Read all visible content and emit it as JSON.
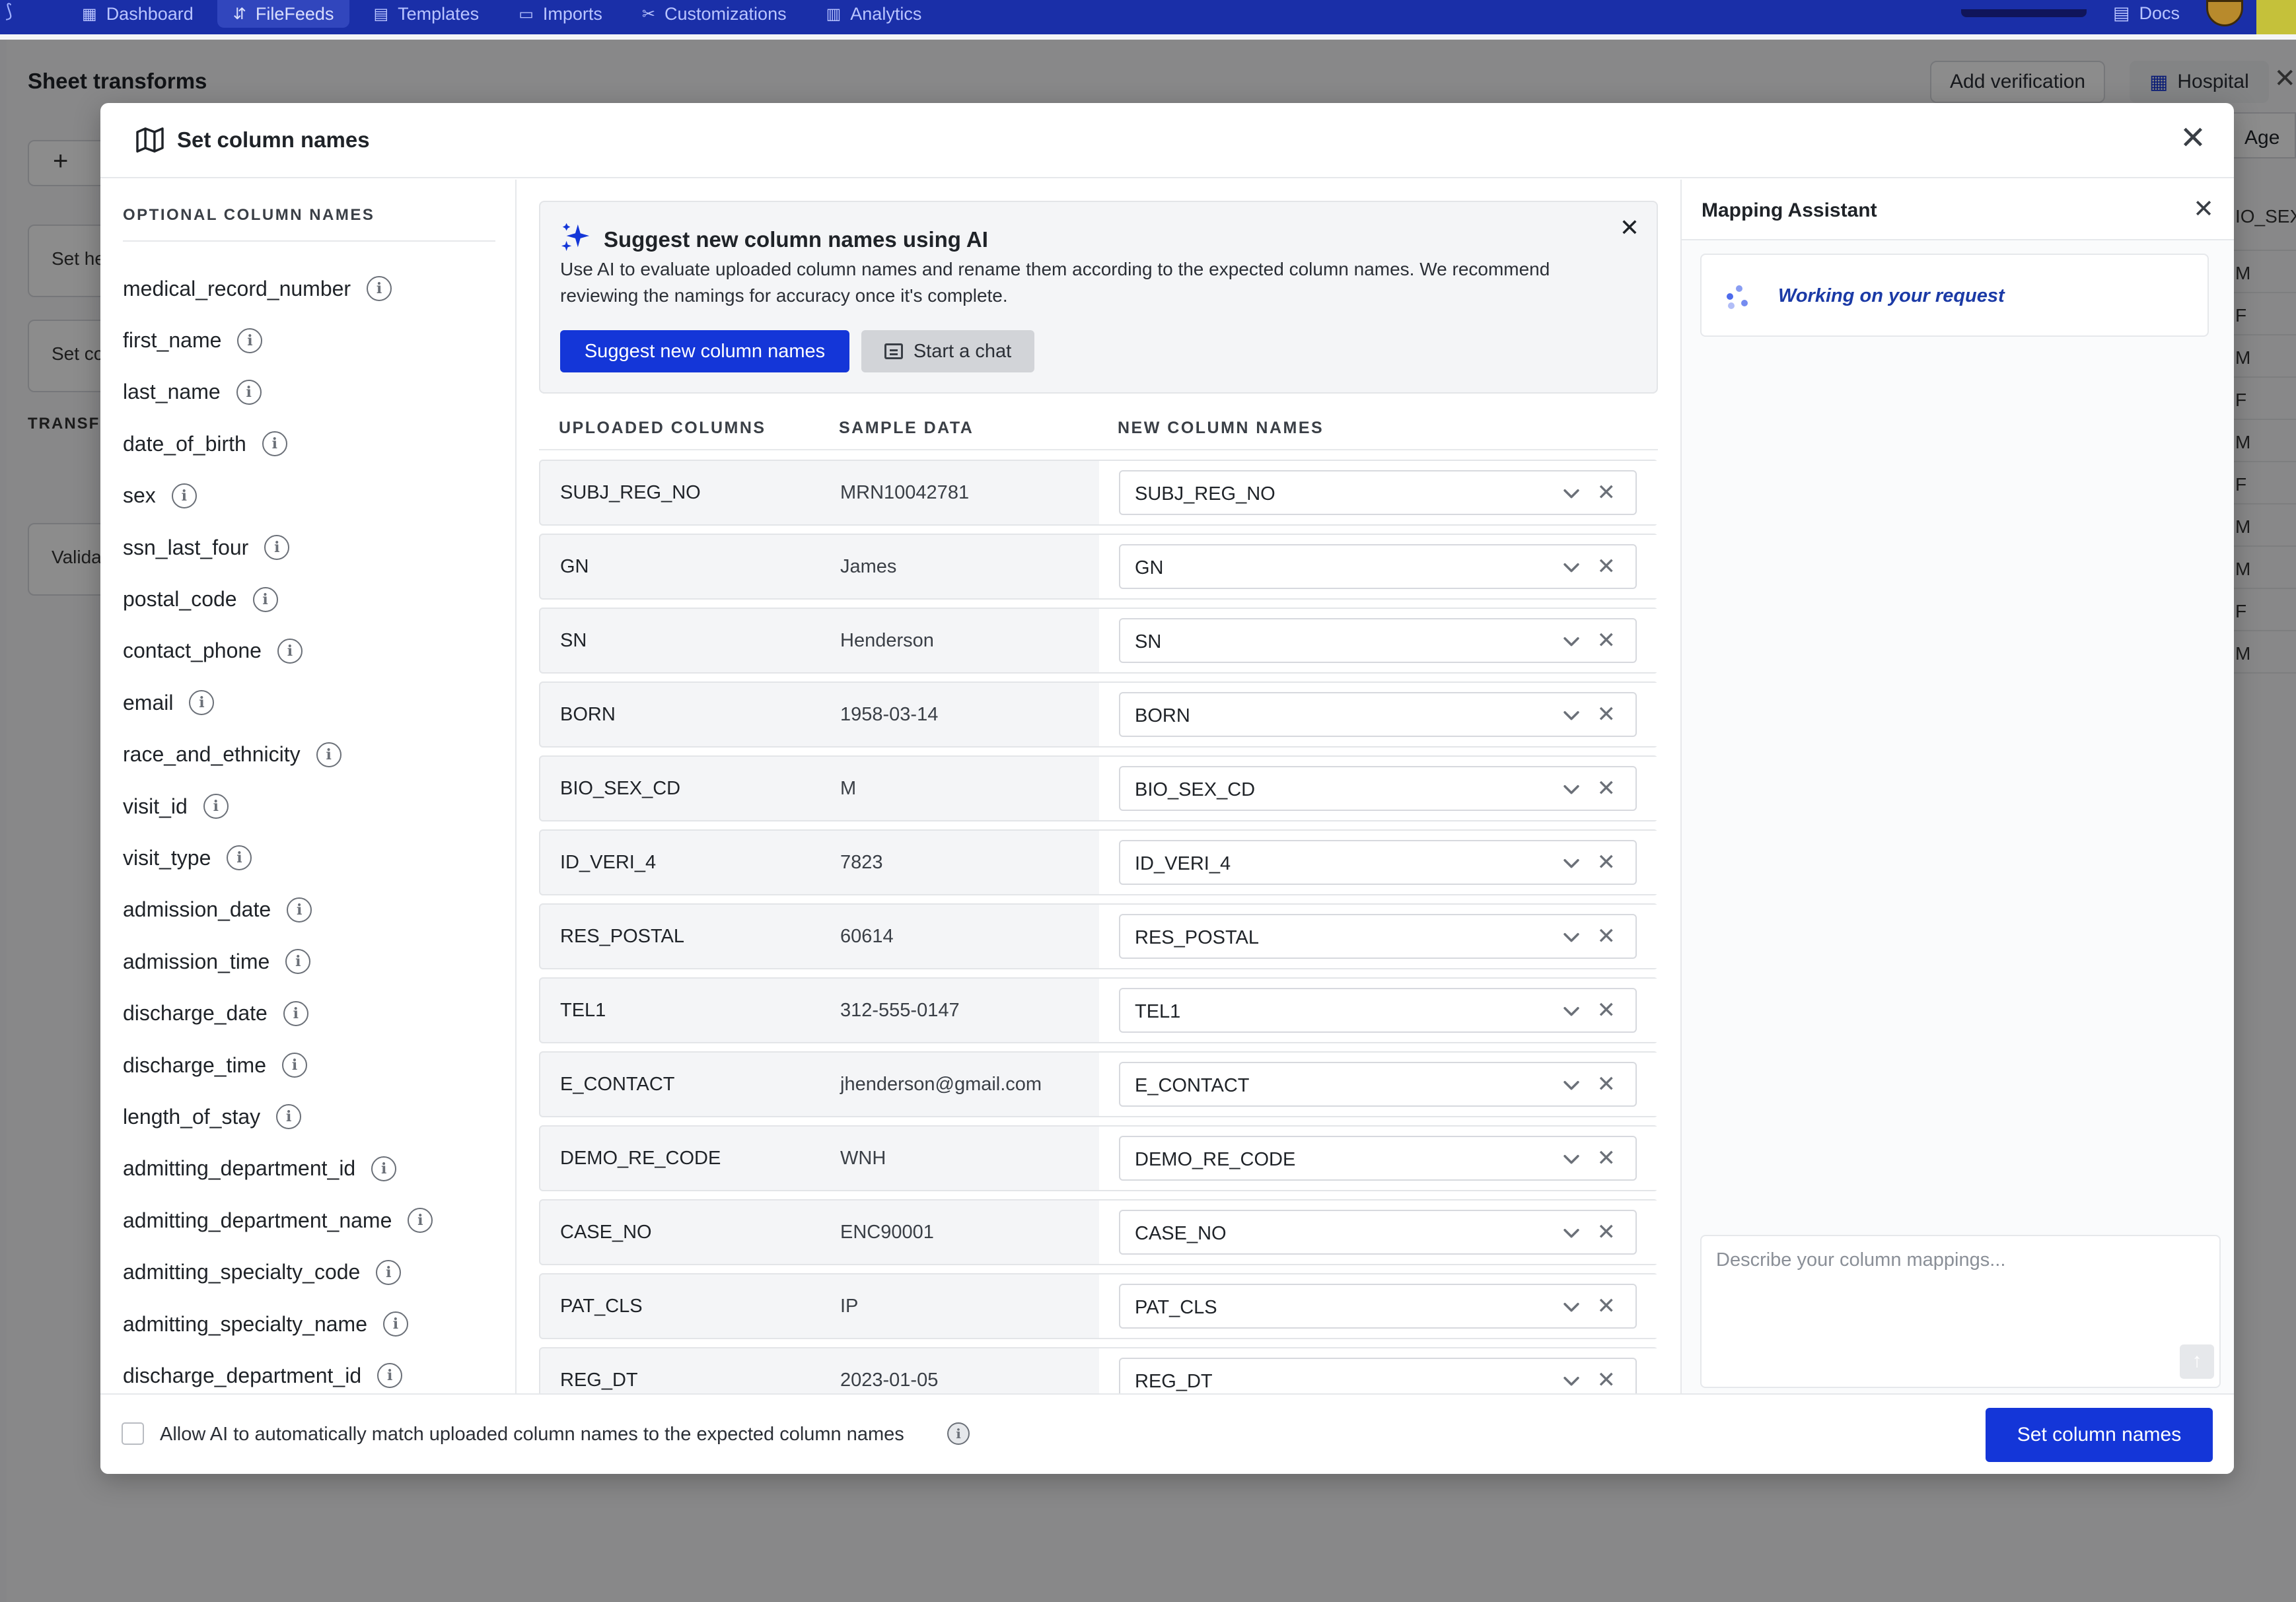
{
  "app_nav": {
    "items": [
      {
        "label": "Dashboard",
        "icon": "grid-icon",
        "active": false
      },
      {
        "label": "FileFeeds",
        "icon": "flow-icon",
        "active": true
      },
      {
        "label": "Templates",
        "icon": "table-icon",
        "active": false
      },
      {
        "label": "Imports",
        "icon": "file-icon",
        "active": false
      },
      {
        "label": "Customizations",
        "icon": "tools-icon",
        "active": false
      },
      {
        "label": "Analytics",
        "icon": "chart-icon",
        "active": false
      }
    ],
    "docs_label": "Docs"
  },
  "background": {
    "page_title": "Sheet transforms",
    "add_verification_label": "Add verification",
    "hospital_label": "Hospital",
    "left_cards": [
      "Set he",
      "Set co"
    ],
    "transforms_label": "TRANSF",
    "validate_card": "Valida",
    "right_header": "Age",
    "right_col_header": "IO_SEX",
    "right_col_values": [
      "M",
      "F",
      "M",
      "F",
      "M",
      "F",
      "M",
      "M",
      "F",
      "M"
    ]
  },
  "modal": {
    "title": "Set column names",
    "optional_heading": "OPTIONAL COLUMN NAMES",
    "optional_columns": [
      "medical_record_number",
      "first_name",
      "last_name",
      "date_of_birth",
      "sex",
      "ssn_last_four",
      "postal_code",
      "contact_phone",
      "email",
      "race_and_ethnicity",
      "visit_id",
      "visit_type",
      "admission_date",
      "admission_time",
      "discharge_date",
      "discharge_time",
      "length_of_stay",
      "admitting_department_id",
      "admitting_department_name",
      "admitting_specialty_code",
      "admitting_specialty_name",
      "discharge_department_id"
    ],
    "ai_card": {
      "title": "Suggest new column names using AI",
      "description": "Use AI to evaluate uploaded column names and rename them according to the expected column names. We recommend reviewing the namings for accuracy once it's complete.",
      "primary_button": "Suggest new column names",
      "secondary_button": "Start a chat"
    },
    "table": {
      "headers": [
        "UPLOADED COLUMNS",
        "SAMPLE DATA",
        "NEW COLUMN NAMES"
      ],
      "rows": [
        {
          "uploaded": "SUBJ_REG_NO",
          "sample": "MRN10042781",
          "new": "SUBJ_REG_NO"
        },
        {
          "uploaded": "GN",
          "sample": "James",
          "new": "GN"
        },
        {
          "uploaded": "SN",
          "sample": "Henderson",
          "new": "SN"
        },
        {
          "uploaded": "BORN",
          "sample": "1958-03-14",
          "new": "BORN"
        },
        {
          "uploaded": "BIO_SEX_CD",
          "sample": "M",
          "new": "BIO_SEX_CD"
        },
        {
          "uploaded": "ID_VERI_4",
          "sample": "7823",
          "new": "ID_VERI_4"
        },
        {
          "uploaded": "RES_POSTAL",
          "sample": "60614",
          "new": "RES_POSTAL"
        },
        {
          "uploaded": "TEL1",
          "sample": "312-555-0147",
          "new": "TEL1"
        },
        {
          "uploaded": "E_CONTACT",
          "sample": "jhenderson@gmail.com",
          "new": "E_CONTACT"
        },
        {
          "uploaded": "DEMO_RE_CODE",
          "sample": "WNH",
          "new": "DEMO_RE_CODE"
        },
        {
          "uploaded": "CASE_NO",
          "sample": "ENC90001",
          "new": "CASE_NO"
        },
        {
          "uploaded": "PAT_CLS",
          "sample": "IP",
          "new": "PAT_CLS"
        },
        {
          "uploaded": "REG_DT",
          "sample": "2023-01-05",
          "new": "REG_DT"
        }
      ]
    },
    "assistant": {
      "title": "Mapping Assistant",
      "status": "Working on your request",
      "input_placeholder": "Describe your column mappings..."
    },
    "footer": {
      "checkbox_label": "Allow AI to automatically match uploaded column names to the expected column names",
      "checked": false,
      "submit_label": "Set column names"
    }
  },
  "colors": {
    "nav_bg": "#1a2fa8",
    "primary": "#1436d8",
    "status_text": "#1b3aa6"
  }
}
